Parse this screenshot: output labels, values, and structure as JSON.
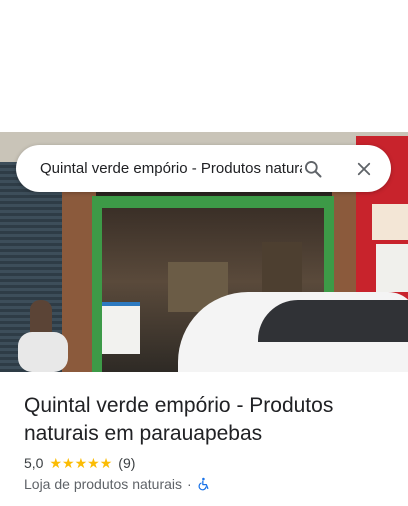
{
  "search": {
    "query": "Quintal verde empório - Produtos naturais em parauapebas"
  },
  "place": {
    "name": "Quintal verde empório - Produtos naturais em parauapebas",
    "rating": "5,0",
    "stars": [
      "★",
      "★",
      "★",
      "★",
      "★"
    ],
    "review_count": "(9)",
    "category": "Loja de produtos naturais",
    "separator": "·"
  },
  "icons": {
    "search": "search-icon",
    "close": "close-icon",
    "star": "star-icon",
    "accessibility": "wheelchair-icon"
  },
  "colors": {
    "star": "#fbbc04",
    "accessibility": "#1a73e8",
    "text_primary": "#202124",
    "text_secondary": "#5f6368"
  }
}
